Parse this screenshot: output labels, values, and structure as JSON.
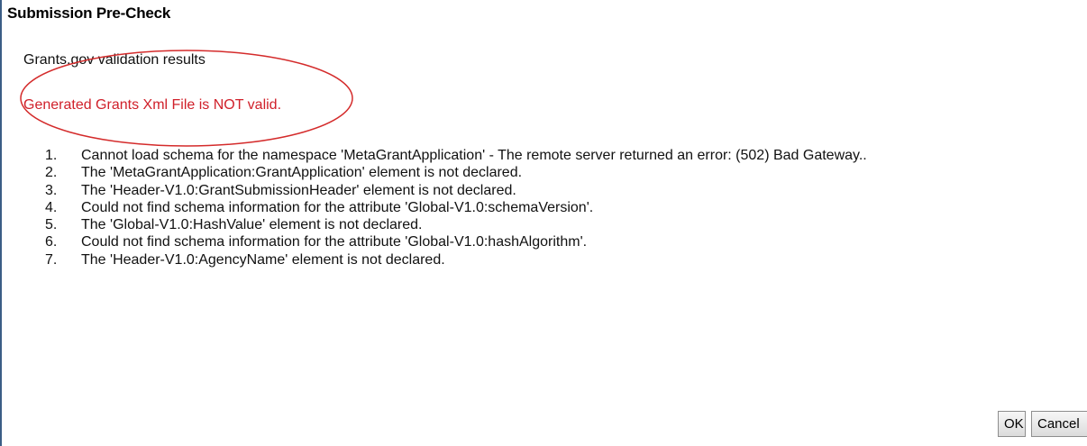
{
  "dialog": {
    "title": "Submission Pre-Check",
    "subtitle": "Grants.gov validation results",
    "status_message": "Generated Grants Xml File is NOT valid.",
    "errors": [
      {
        "number": "1.",
        "text": "Cannot load schema for the namespace 'MetaGrantApplication' - The remote server returned an error: (502) Bad Gateway.."
      },
      {
        "number": "2.",
        "text": "The 'MetaGrantApplication:GrantApplication' element is not declared."
      },
      {
        "number": "3.",
        "text": "The 'Header-V1.0:GrantSubmissionHeader' element is not declared."
      },
      {
        "number": "4.",
        "text": "Could not find schema information for the attribute 'Global-V1.0:schemaVersion'."
      },
      {
        "number": "5.",
        "text": "The 'Global-V1.0:HashValue' element is not declared."
      },
      {
        "number": "6.",
        "text": "Could not find schema information for the attribute 'Global-V1.0:hashAlgorithm'."
      },
      {
        "number": "7.",
        "text": "The 'Header-V1.0:AgencyName' element is not declared."
      }
    ],
    "buttons": {
      "ok_label": "OK",
      "cancel_label": "Cancel"
    }
  },
  "colors": {
    "status_error": "#d0202a",
    "annotation_circle": "#d42b2b",
    "window_border": "#3b5d86"
  }
}
